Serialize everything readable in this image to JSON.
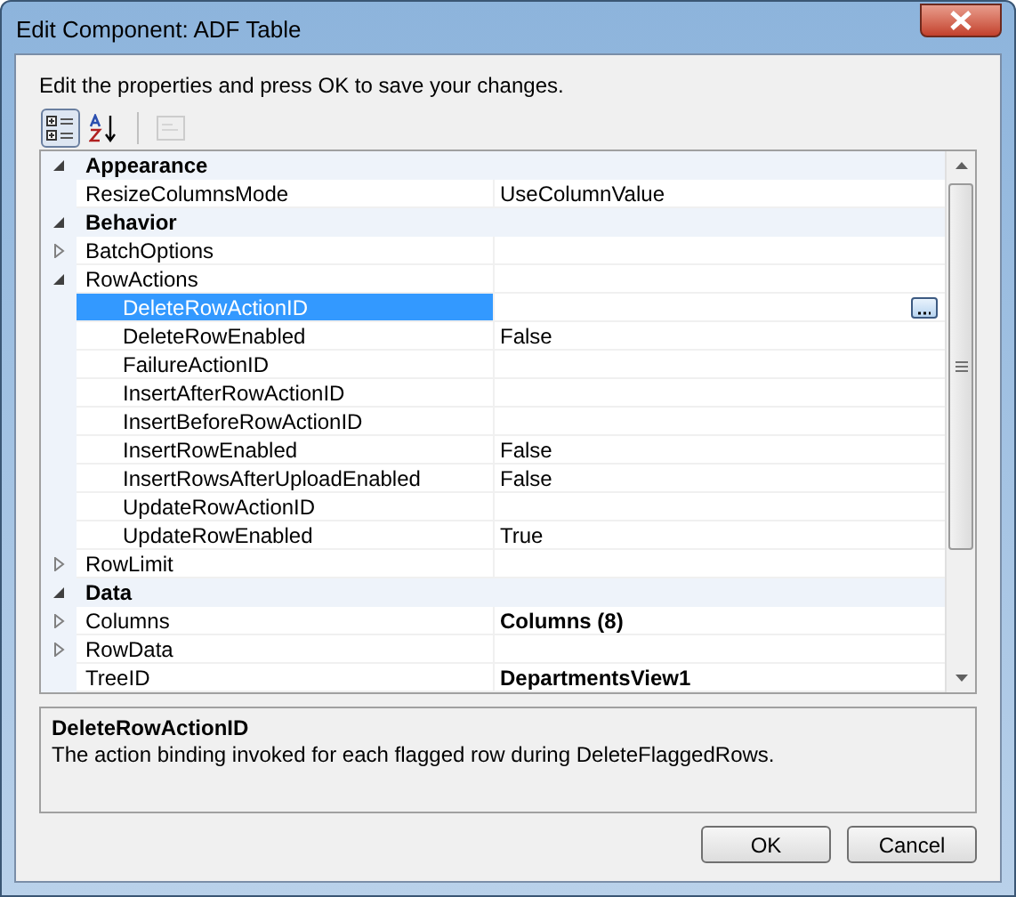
{
  "window": {
    "title": "Edit Component: ADF Table"
  },
  "instruction": "Edit the properties and press OK to save your changes.",
  "toolbar": [
    {
      "kind": "categorized",
      "selected": true,
      "disabled": false
    },
    {
      "kind": "alphabetical",
      "selected": false,
      "disabled": false
    },
    {
      "kind": "pages",
      "selected": false,
      "disabled": true
    }
  ],
  "grid": [
    {
      "kind": "category",
      "name": "Appearance",
      "expanded": true,
      "children": [
        {
          "kind": "property",
          "name": "ResizeColumnsMode",
          "value": "UseColumnValue",
          "selected": false
        }
      ]
    },
    {
      "kind": "category",
      "name": "Behavior",
      "expanded": true,
      "children": [
        {
          "kind": "property",
          "name": "BatchOptions",
          "expanded": false,
          "selected": false
        },
        {
          "kind": "property",
          "name": "RowActions",
          "expanded": true,
          "selected": false,
          "children": [
            {
              "kind": "property",
              "name": "DeleteRowActionID",
              "selected": true
            },
            {
              "kind": "property",
              "name": "DeleteRowEnabled",
              "value": "False",
              "selected": false
            },
            {
              "kind": "property",
              "name": "FailureActionID",
              "selected": false
            },
            {
              "kind": "property",
              "name": "InsertAfterRowActionID",
              "selected": false
            },
            {
              "kind": "property",
              "name": "InsertBeforeRowActionID",
              "selected": false
            },
            {
              "kind": "property",
              "name": "InsertRowEnabled",
              "value": "False",
              "selected": false
            },
            {
              "kind": "property",
              "name": "InsertRowsAfterUploadEnabled",
              "value": "False",
              "selected": false
            },
            {
              "kind": "property",
              "name": "UpdateRowActionID",
              "selected": false
            },
            {
              "kind": "property",
              "name": "UpdateRowEnabled",
              "value": "True",
              "selected": false
            }
          ]
        },
        {
          "kind": "property",
          "name": "RowLimit",
          "expanded": false,
          "selected": false
        }
      ]
    },
    {
      "kind": "category",
      "name": "Data",
      "expanded": true,
      "children": [
        {
          "kind": "property",
          "name": "Columns",
          "expanded": false,
          "value": "Columns (8)",
          "modified": true,
          "selected": false
        },
        {
          "kind": "property",
          "name": "RowData",
          "expanded": false,
          "selected": false
        },
        {
          "kind": "property",
          "name": "TreeID",
          "value": "DepartmentsView1",
          "modified": true,
          "selected": false
        }
      ]
    }
  ],
  "description": {
    "title": "DeleteRowActionID",
    "text": "The action binding invoked for each flagged row during DeleteFlaggedRows."
  },
  "buttons": [
    "OK",
    "Cancel"
  ]
}
